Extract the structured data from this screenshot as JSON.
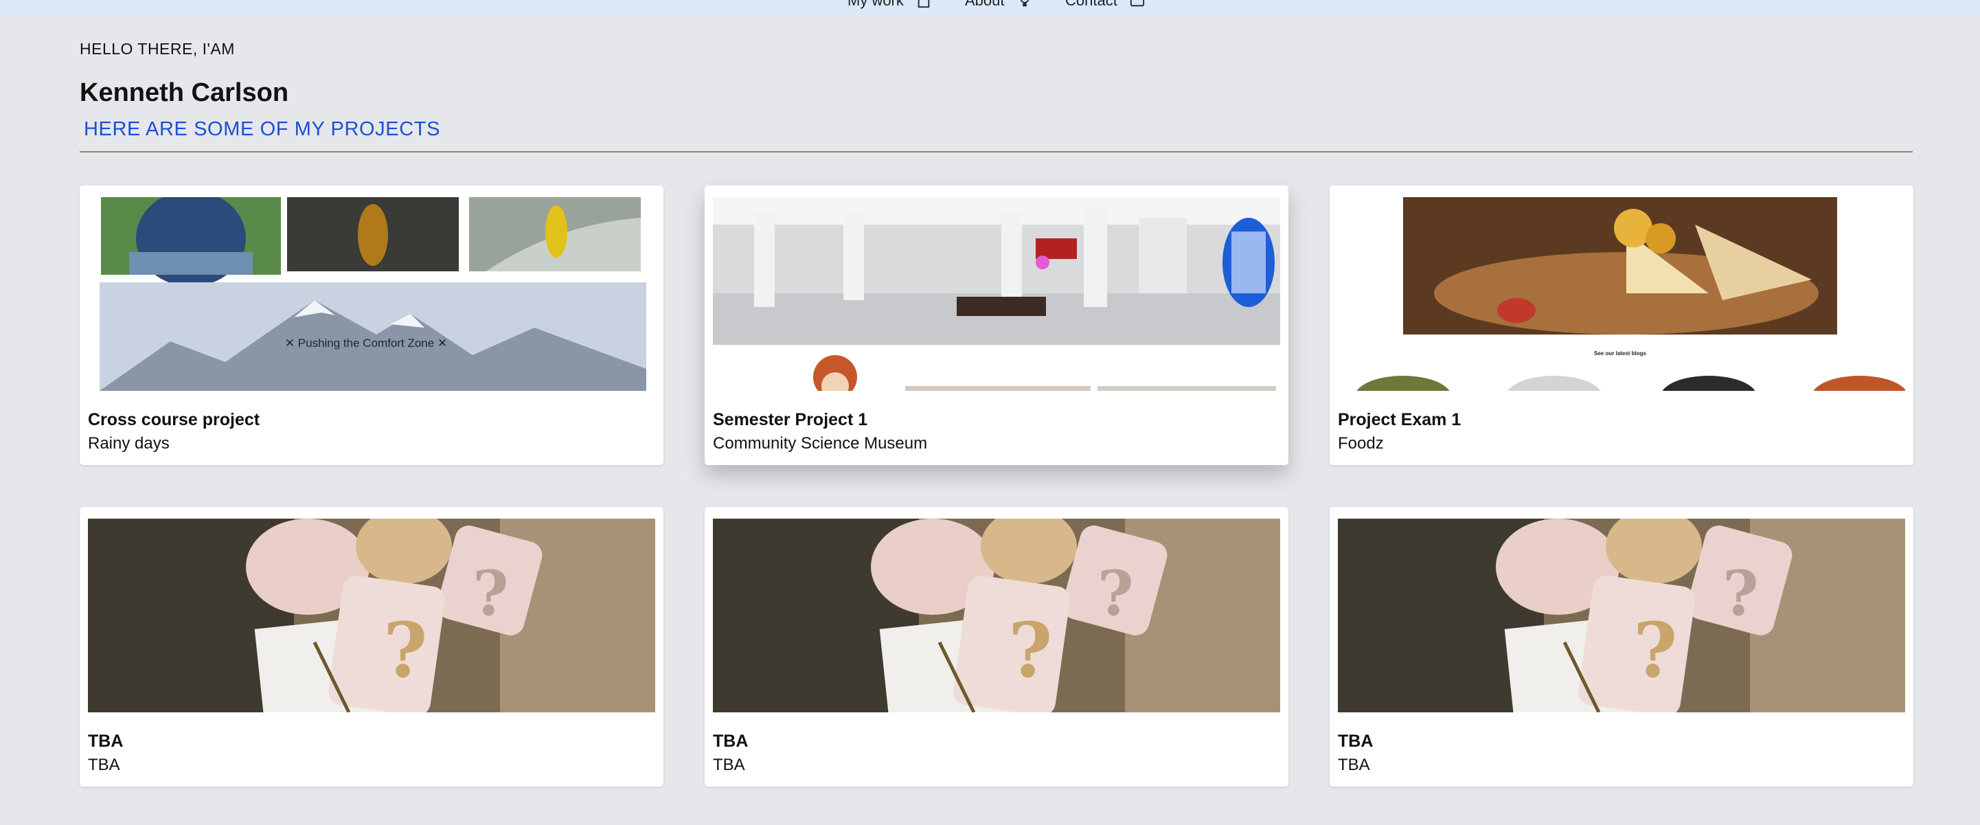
{
  "nav": {
    "items": [
      {
        "label": "My work",
        "icon": "building-icon"
      },
      {
        "label": "About",
        "icon": "lightbulb-icon"
      },
      {
        "label": "Contact",
        "icon": "mail-icon"
      }
    ]
  },
  "hero": {
    "greeting": "HELLO THERE, I'AM",
    "name": "Kenneth Carlson",
    "projects_heading": "HERE ARE SOME OF MY PROJECTS"
  },
  "projects": [
    {
      "title": "Cross course project",
      "subtitle": "Rainy days",
      "thumb_text": "✕ Pushing the Comfort Zone ✕"
    },
    {
      "title": "Semester Project 1",
      "subtitle": "Community Science Museum"
    },
    {
      "title": "Project Exam 1",
      "subtitle": "Foodz",
      "thumb_text": "See our latest blogs"
    },
    {
      "title": "TBA",
      "subtitle": "TBA"
    },
    {
      "title": "TBA",
      "subtitle": "TBA"
    },
    {
      "title": "TBA",
      "subtitle": "TBA"
    }
  ],
  "colors": {
    "background": "#e5e7eb",
    "nav_bg": "#dbe8f9",
    "accent_blue": "#1d4fd1",
    "divider": "#b07a6e"
  }
}
